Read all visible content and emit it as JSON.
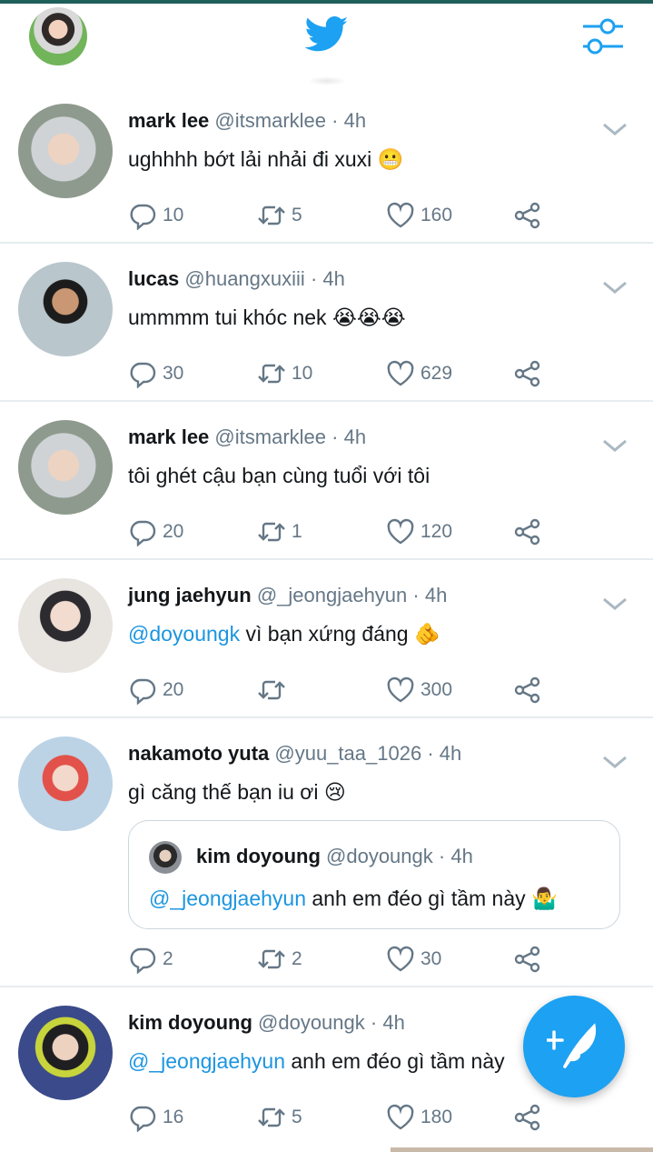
{
  "header": {
    "logo_icon": "twitter-bird-icon",
    "settings_icon": "sliders-icon",
    "accent_color": "#1da1f2"
  },
  "tweets": [
    {
      "name": "mark lee",
      "handle": "@itsmarklee",
      "dot": "·",
      "time": "4h",
      "mention": "",
      "text": "ughhhh bớt lải nhải đi xuxi",
      "emoji": [
        "😬"
      ],
      "replies": "10",
      "retweets": "5",
      "likes": "160"
    },
    {
      "name": "lucas",
      "handle": "@huangxuxiii",
      "dot": "·",
      "time": "4h",
      "mention": "",
      "text": "ummmm tui khóc nek",
      "emoji": [
        "😭",
        "😭",
        "😭"
      ],
      "replies": "30",
      "retweets": "10",
      "likes": "629"
    },
    {
      "name": "mark lee",
      "handle": "@itsmarklee",
      "dot": "·",
      "time": "4h",
      "mention": "",
      "text": "tôi ghét cậu bạn cùng tuổi với tôi",
      "emoji": [],
      "replies": "20",
      "retweets": "1",
      "likes": "120"
    },
    {
      "name": "jung jaehyun",
      "handle": "@_jeongjaehyun",
      "dot": "·",
      "time": "4h",
      "mention": "@doyoungk",
      "text": " vì bạn xứng đáng",
      "emoji": [
        "🫵"
      ],
      "replies": "20",
      "retweets": "",
      "likes": "300"
    },
    {
      "name": "nakamoto yuta",
      "handle": "@yuu_taa_1026",
      "dot": "·",
      "time": "4h",
      "mention": "",
      "text": "gì căng thế bạn iu ơi",
      "emoji": [
        "😢"
      ],
      "replies": "2",
      "retweets": "2",
      "likes": "30",
      "quote": {
        "name": "kim doyoung",
        "handle": "@doyoungk",
        "dot": "·",
        "time": "4h",
        "mention": "@_jeongjaehyun",
        "text": " anh em đéo gì tầm này",
        "emoji": [
          "🤷‍♂️"
        ]
      }
    },
    {
      "name": "kim doyoung",
      "handle": "@doyoungk",
      "dot": "·",
      "time": "4h",
      "mention": "@_jeongjaehyun",
      "text": " anh em đéo gì tầm này",
      "emoji": [],
      "replies": "16",
      "retweets": "5",
      "likes": "180"
    }
  ],
  "fab": {
    "icon": "compose-tweet-icon"
  }
}
